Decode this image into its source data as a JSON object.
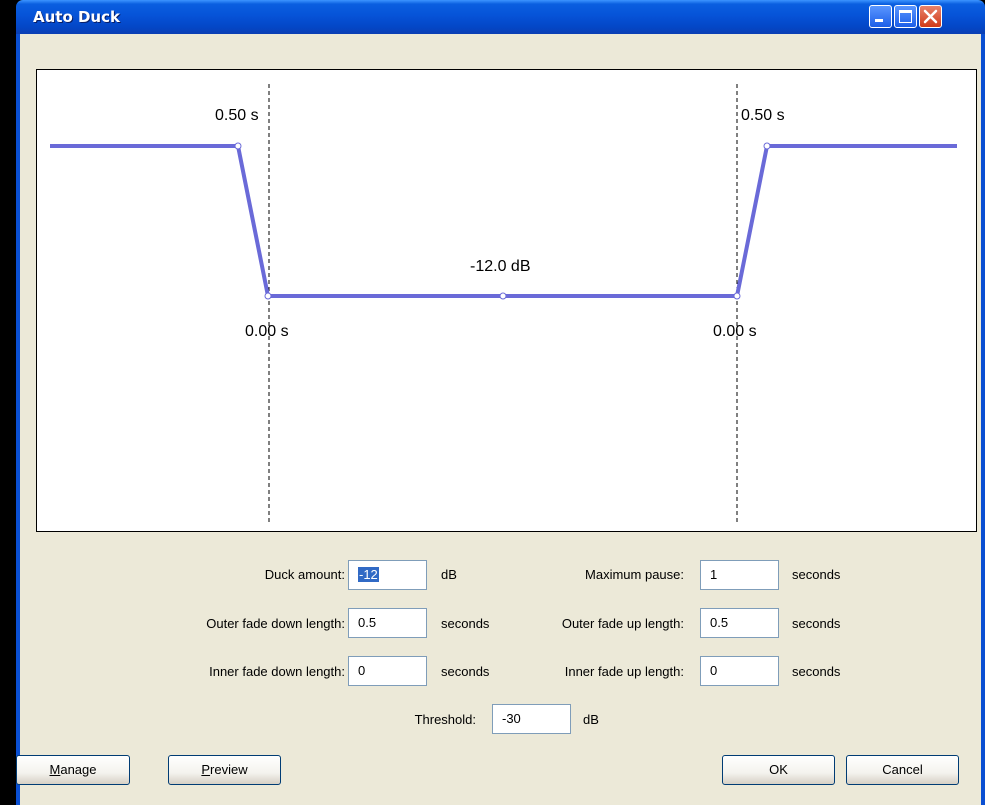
{
  "window": {
    "title": "Auto Duck"
  },
  "graph": {
    "fade_down_outer_label": "0.50 s",
    "fade_up_outer_label": "0.50 s",
    "duck_amount_label": "-12.0 dB",
    "fade_down_inner_label": "0.00 s",
    "fade_up_inner_label": "0.00 s",
    "line_color": "#6a6ad8"
  },
  "fields": {
    "duck_amount": {
      "label": "Duck amount:",
      "value": "-12",
      "unit": "dB"
    },
    "maximum_pause": {
      "label": "Maximum pause:",
      "value": "1",
      "unit": "seconds"
    },
    "outer_fade_down": {
      "label": "Outer fade down length:",
      "value": "0.5",
      "unit": "seconds"
    },
    "outer_fade_up": {
      "label": "Outer fade up length:",
      "value": "0.5",
      "unit": "seconds"
    },
    "inner_fade_down": {
      "label": "Inner fade down length:",
      "value": "0",
      "unit": "seconds"
    },
    "inner_fade_up": {
      "label": "Inner fade up length:",
      "value": "0",
      "unit": "seconds"
    },
    "threshold": {
      "label": "Threshold:",
      "value": "-30",
      "unit": "dB"
    }
  },
  "buttons": {
    "manage": "Manage",
    "preview": "Preview",
    "ok": "OK",
    "cancel": "Cancel"
  },
  "mnemonics": {
    "manage": "M",
    "preview": "P"
  }
}
